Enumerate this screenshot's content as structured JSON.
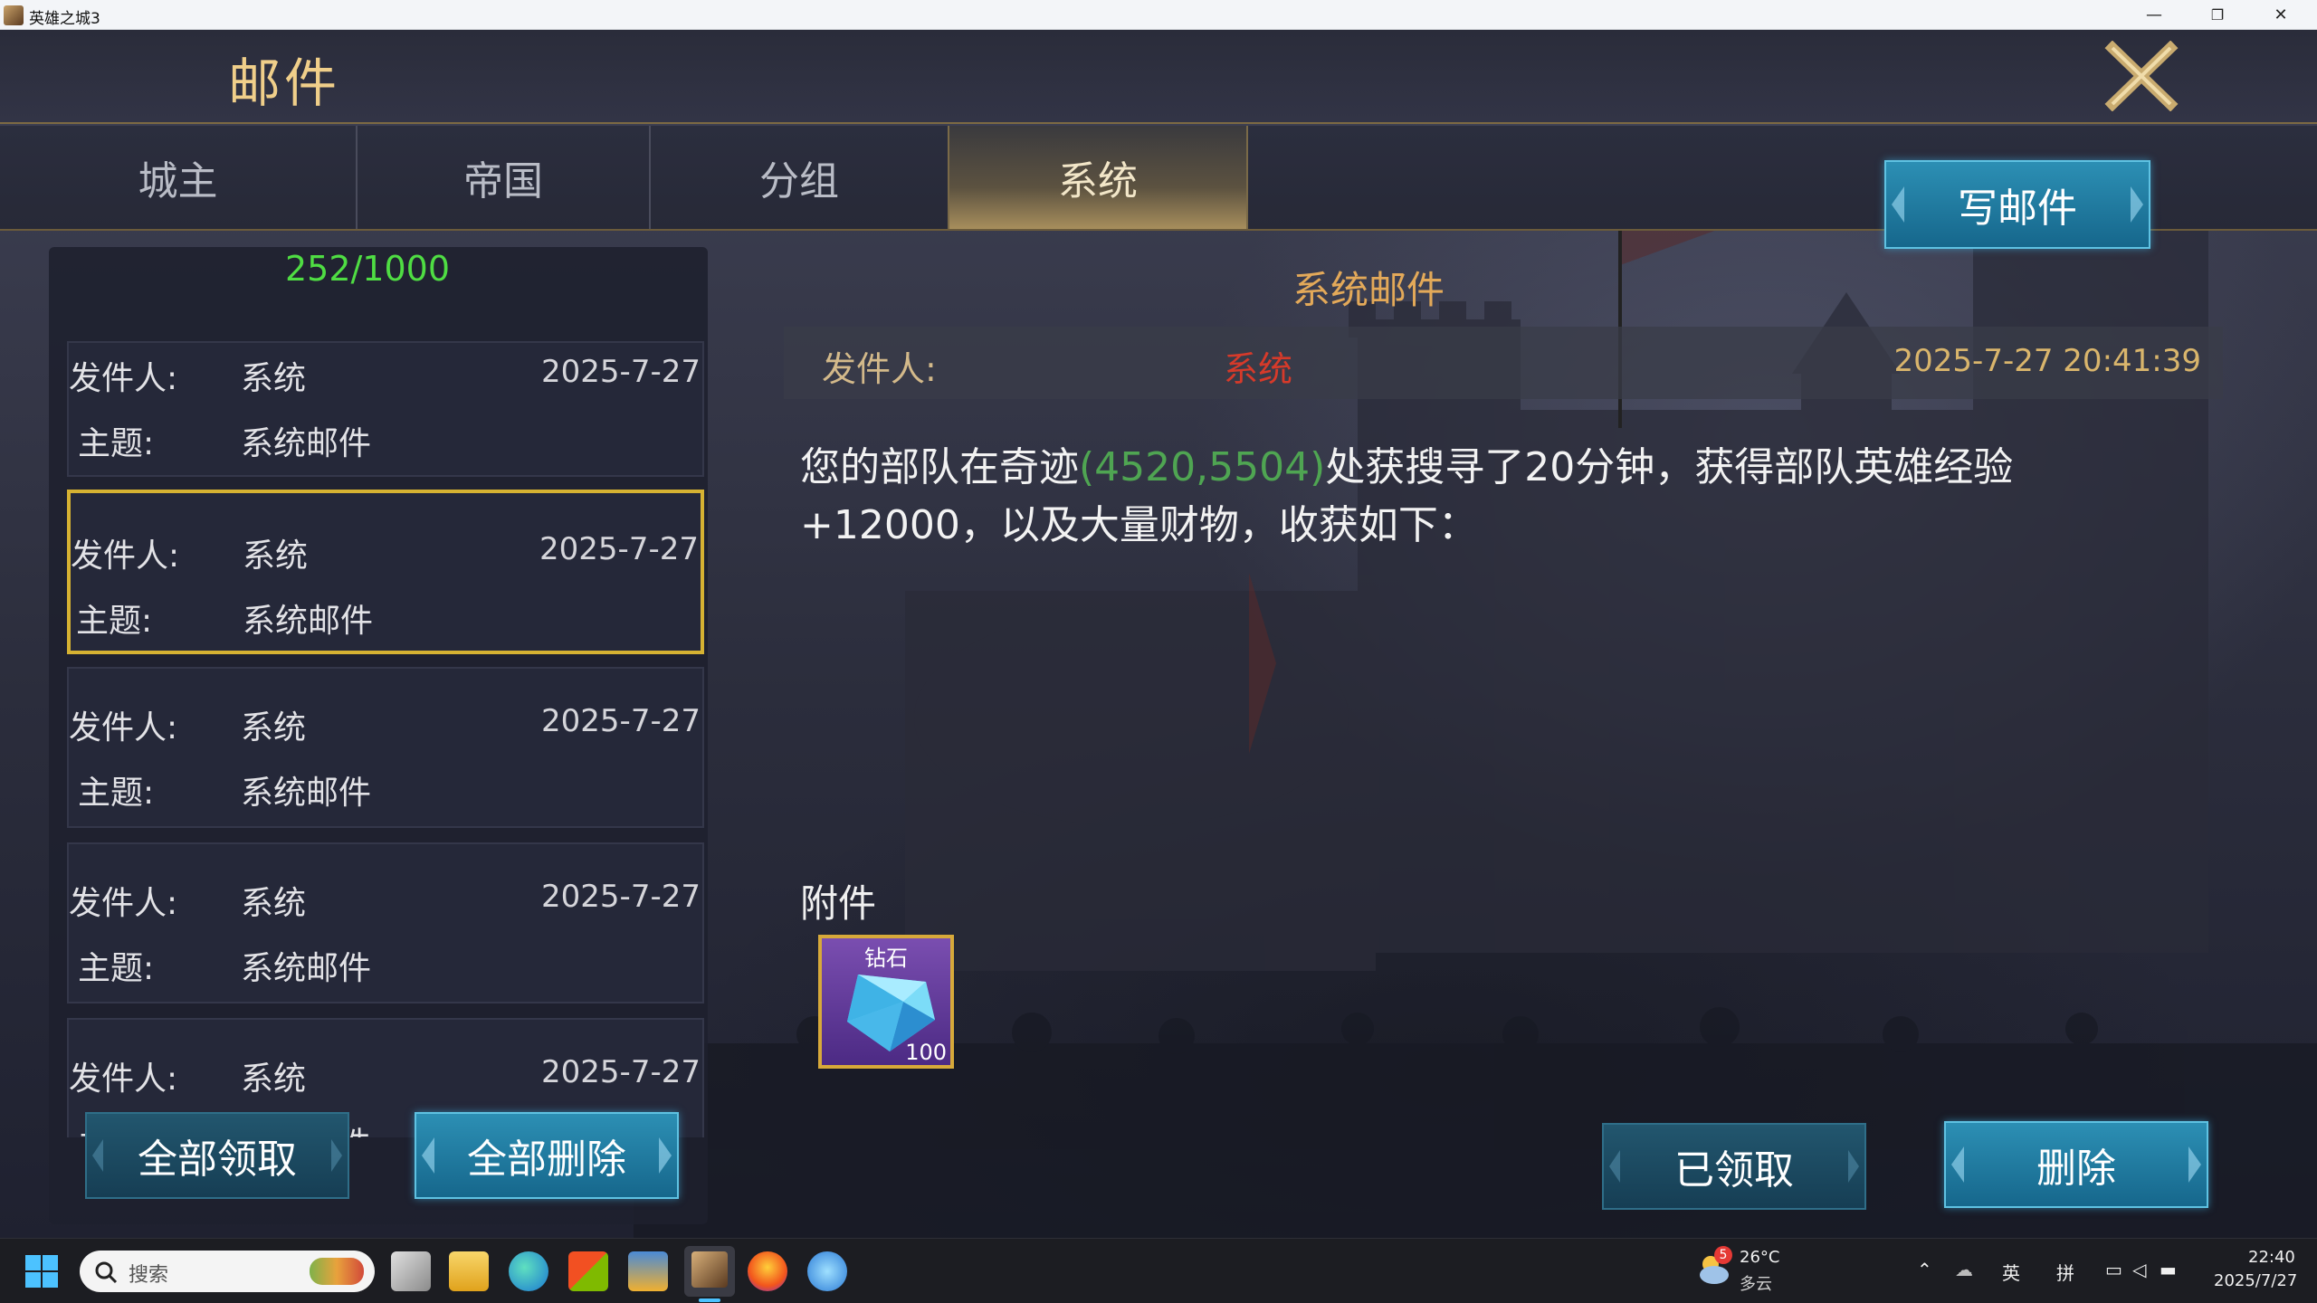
{
  "window": {
    "title": "英雄之城3",
    "minimize": "—",
    "restore": "❐",
    "close": "✕"
  },
  "header": {
    "title": "邮件",
    "close_icon": "close-x-icon"
  },
  "tabs": [
    {
      "label": "城主"
    },
    {
      "label": "帝国"
    },
    {
      "label": "分组"
    },
    {
      "label": "系统",
      "active": true
    }
  ],
  "compose_button": "写邮件",
  "mail_list": {
    "count": "252/1000",
    "sender_label": "发件人:",
    "subject_label": "主题:",
    "items": [
      {
        "sender": "系统",
        "subject": "系统邮件",
        "date": "2025-7-27"
      },
      {
        "sender": "系统",
        "subject": "系统邮件",
        "date": "2025-7-27",
        "selected": true
      },
      {
        "sender": "系统",
        "subject": "系统邮件",
        "date": "2025-7-27"
      },
      {
        "sender": "系统",
        "subject": "系统邮件",
        "date": "2025-7-27"
      },
      {
        "sender": "系统",
        "subject": "系统邮件",
        "date": "2025-7-27"
      }
    ]
  },
  "list_buttons": {
    "claim_all": "全部领取",
    "delete_all": "全部删除"
  },
  "detail": {
    "title": "系统邮件",
    "sender_label": "发件人:",
    "sender": "系统",
    "datetime": "2025-7-27  20:41:39",
    "body_before": "您的部队在奇迹",
    "body_coords": "(4520,5504)",
    "body_after": "处获搜寻了20分钟，获得部队英雄经验+12000，以及大量财物，收获如下：",
    "attachment_label": "附件",
    "attachment": {
      "name": "钻石",
      "count": "100",
      "icon": "diamond-icon"
    }
  },
  "detail_buttons": {
    "claimed": "已领取",
    "delete": "删除"
  },
  "taskbar": {
    "search_placeholder": "搜索",
    "weather": {
      "badge": "5",
      "temp": "26°C",
      "desc": "多云"
    },
    "ime_lang": "英",
    "ime_mode": "拼",
    "time": "22:40",
    "date": "2025/7/27"
  },
  "colors": {
    "accent_gold": "#d6b232",
    "button_blue": "#1f7ea3",
    "count_green": "#4fdd43",
    "sender_red": "#d63a2a",
    "coords_green": "#4fa552"
  }
}
